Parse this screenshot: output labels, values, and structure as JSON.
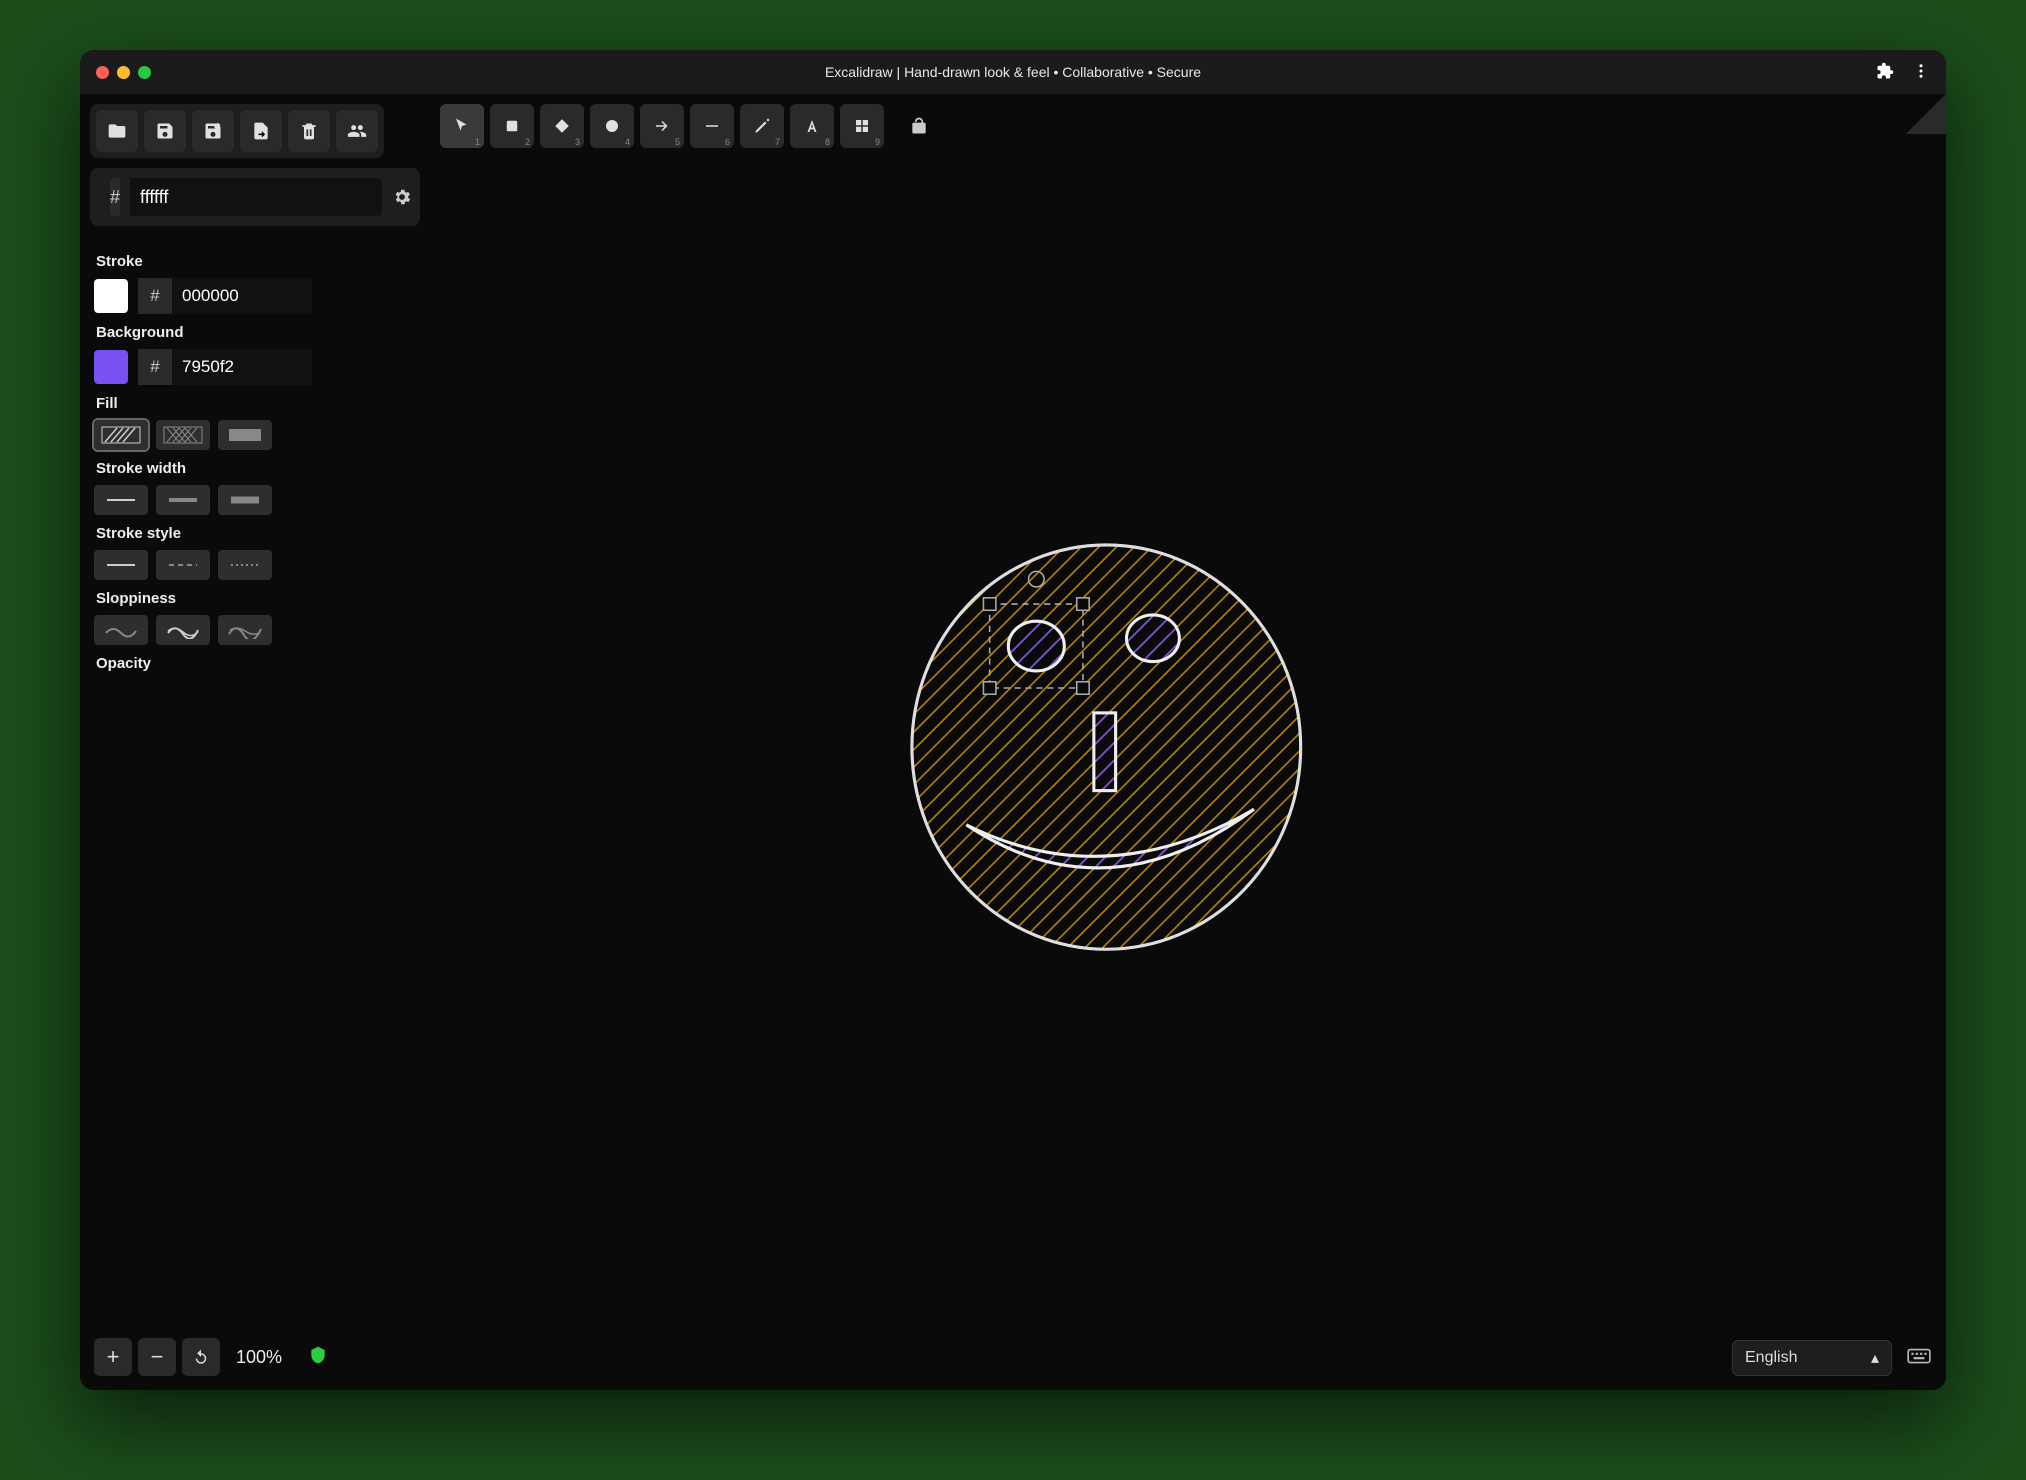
{
  "window": {
    "title": "Excalidraw | Hand-drawn look & feel • Collaborative • Secure"
  },
  "canvas_color": {
    "hash": "#",
    "hex": "ffffff"
  },
  "tools": {
    "numbers": [
      "1",
      "2",
      "3",
      "4",
      "5",
      "6",
      "7",
      "8",
      "9"
    ]
  },
  "props": {
    "stroke_label": "Stroke",
    "stroke_hex": "000000",
    "stroke_swatch": "#ffffff",
    "background_label": "Background",
    "background_hex": "7950f2",
    "background_swatch": "#7950f2",
    "fill_label": "Fill",
    "stroke_width_label": "Stroke width",
    "stroke_style_label": "Stroke style",
    "sloppiness_label": "Sloppiness",
    "opacity_label": "Opacity",
    "hash": "#"
  },
  "zoom": {
    "level": "100%"
  },
  "language": {
    "selected": "English"
  }
}
